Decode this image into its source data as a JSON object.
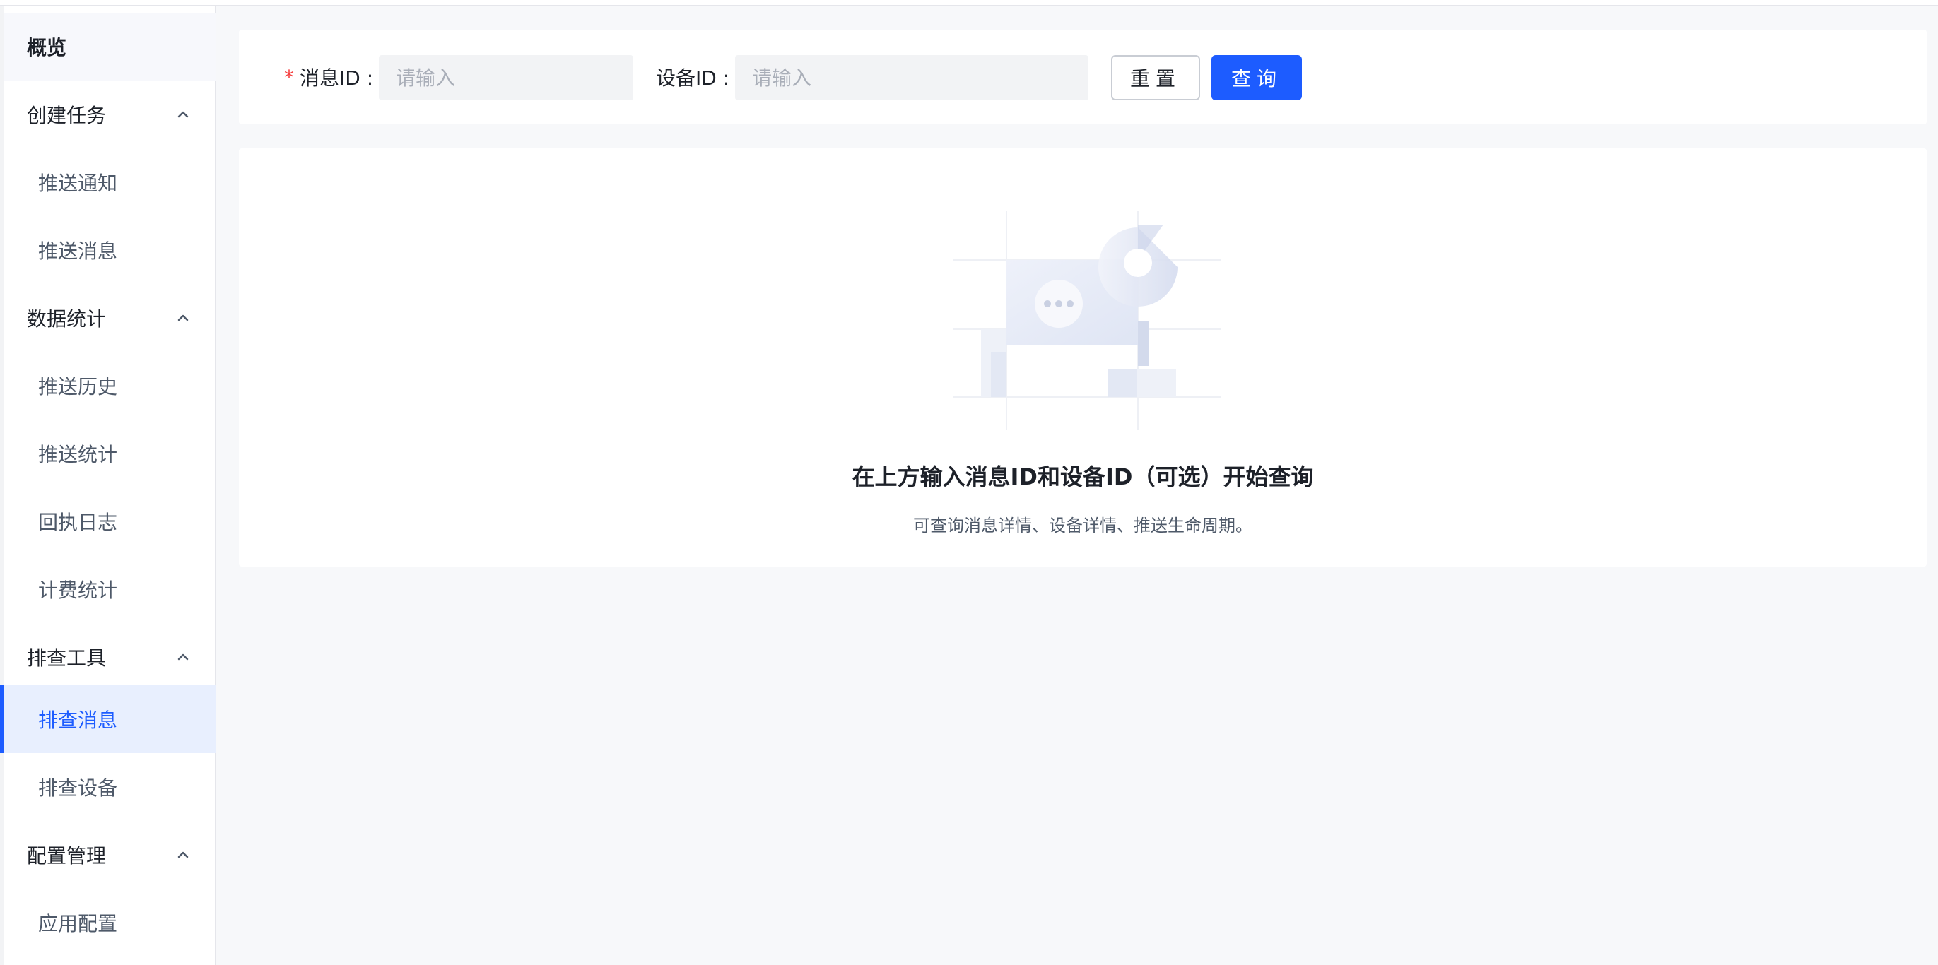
{
  "sidebar": {
    "overview": "概览",
    "groups": [
      {
        "label": "创建任务",
        "items": [
          "推送通知",
          "推送消息"
        ]
      },
      {
        "label": "数据统计",
        "items": [
          "推送历史",
          "推送统计",
          "回执日志",
          "计费统计"
        ]
      },
      {
        "label": "排查工具",
        "items": [
          "排查消息",
          "排查设备"
        ]
      },
      {
        "label": "配置管理",
        "items": [
          "应用配置"
        ]
      }
    ],
    "active_item": "排查消息"
  },
  "filter": {
    "message_id_label": "消息ID :",
    "required_mark": "*",
    "message_id_placeholder": "请输入",
    "device_id_label": "设备ID :",
    "device_id_placeholder": "请输入",
    "reset_label": "重置",
    "query_label": "查询"
  },
  "empty_state": {
    "title": "在上方输入消息ID和设备ID（可选）开始查询",
    "description": "可查询消息详情、设备详情、推送生命周期。",
    "illustration_icon": "empty-chat-illustration"
  },
  "colors": {
    "accent": "#1d5cff",
    "active_bg": "#e8effe",
    "required": "#f53f3f",
    "page_bg": "#f7f8fa"
  }
}
